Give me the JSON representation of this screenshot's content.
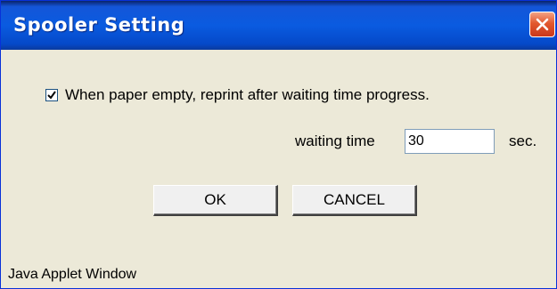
{
  "window": {
    "title": "Spooler Setting",
    "close_icon": "close-icon",
    "title_color": "#0a5be0",
    "close_color": "#e2582e"
  },
  "options": {
    "reprint_checked": true,
    "reprint_label": "When paper empty, reprint after waiting time progress."
  },
  "waiting": {
    "label": "waiting time",
    "value": "30",
    "unit": "sec."
  },
  "buttons": {
    "ok_label": "OK",
    "cancel_label": "CANCEL"
  },
  "status": {
    "text": "Java Applet Window"
  }
}
